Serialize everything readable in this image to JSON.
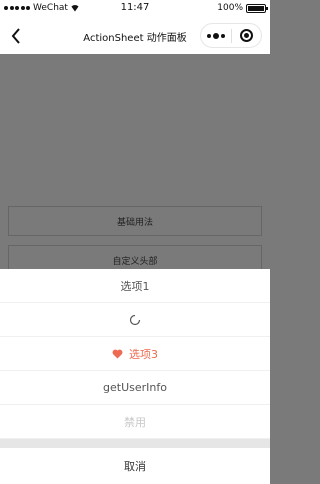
{
  "status_bar": {
    "carrier": "WeChat",
    "time": "11:47",
    "battery": "100%",
    "battery_level": 1.0
  },
  "nav": {
    "title": "ActionSheet 动作面板"
  },
  "page": {
    "buttons": [
      "基础用法",
      "自定义头部"
    ]
  },
  "action_sheet": {
    "items": [
      {
        "label": "选项1",
        "type": "normal"
      },
      {
        "label": "",
        "type": "loading"
      },
      {
        "label": "选项3",
        "type": "danger",
        "icon": "heart-icon",
        "color": "#ee6a50"
      },
      {
        "label": "getUserInfo",
        "type": "normal"
      },
      {
        "label": "禁用",
        "type": "disabled"
      }
    ],
    "cancel_label": "取消"
  }
}
